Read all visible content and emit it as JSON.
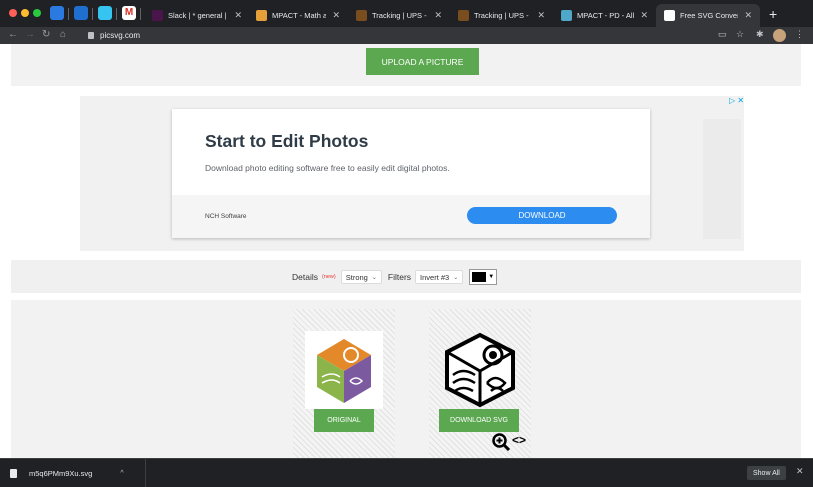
{
  "browser": {
    "tabs": [
      {
        "title": "Slack | * general | The",
        "favicon_color": "#4a154b",
        "active": false
      },
      {
        "title": "MPACT - Math and C",
        "favicon_color": "#e5a03a",
        "active": false
      },
      {
        "title": "Tracking | UPS - Unit",
        "favicon_color": "#7a4d1f",
        "active": false
      },
      {
        "title": "Tracking | UPS - Unit",
        "favicon_color": "#7a4d1f",
        "active": false
      },
      {
        "title": "MPACT - PD - All Dov",
        "favicon_color": "#4fa8c7",
        "active": false
      },
      {
        "title": "Free SVG Converter",
        "favicon_color": "#ffffff",
        "active": true
      }
    ],
    "new_tab": "+",
    "url": "picsvg.com",
    "icons": [
      "back-arrow-icon",
      "forward-arrow-icon",
      "reload-icon",
      "home-icon",
      "lock-icon",
      "cast-icon",
      "star-icon",
      "extensions-icon",
      "profile-avatar",
      "menu-icon"
    ]
  },
  "page": {
    "upload_button": "UPLOAD A PICTURE",
    "ad": {
      "choices_label": "▷ ✕",
      "headline": "Start to Edit Photos",
      "body": "Download photo editing software free to easily edit digital photos.",
      "advertiser": "NCH Software",
      "cta": "DOWNLOAD",
      "cta_color": "#2d8cf0"
    },
    "controls": {
      "details_label": "Details",
      "details_badge": "(new)",
      "details_value": "Strong",
      "filters_label": "Filters",
      "filters_value": "Invert #3",
      "color_value": "#000000"
    },
    "results": {
      "original_button": "ORIGINAL",
      "download_button": "DOWNLOAD SVG",
      "accent": "#5ca851"
    }
  },
  "downloads": {
    "filename": "m5q6PMm9Xu.svg",
    "show_all": "Show All"
  }
}
